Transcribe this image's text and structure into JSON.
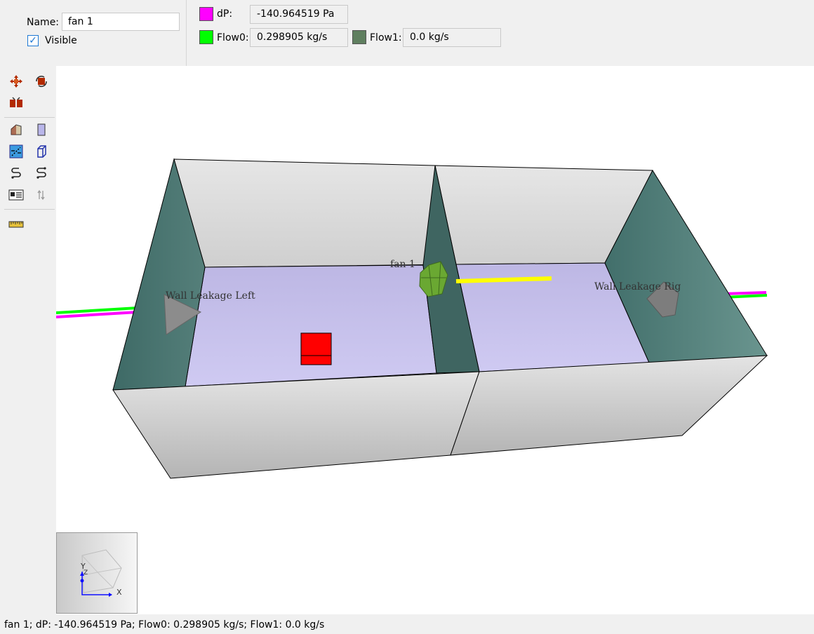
{
  "properties": {
    "name_label": "Name:",
    "name_value": "fan 1",
    "visible_label": "Visible",
    "visible_checked": true
  },
  "readouts": {
    "dp": {
      "label": "dP:",
      "value": "-140.964519 Pa",
      "color": "#ff00ff"
    },
    "flow0": {
      "label": "Flow0:",
      "value": "0.298905 kg/s",
      "color": "#00ff00"
    },
    "flow1": {
      "label": "Flow1:",
      "value": "0.0 kg/s",
      "color": "#5f7f5f"
    }
  },
  "toolbar": {
    "icons": [
      "move-icon",
      "rotate-icon",
      "group-icon",
      "room-shape-icon",
      "wall-panel-icon",
      "flow-grid-icon",
      "box-outline-icon",
      "path-link-icon",
      "path-link-alt-icon",
      "table-icon",
      "dimension-icon",
      "ruler-icon"
    ]
  },
  "scene": {
    "labels": {
      "fan": "fan 1",
      "wall_left": "Wall Leakage Left",
      "wall_right": "Wall Leakage Rig"
    },
    "colors": {
      "floor": "#c8c2ec",
      "wall_outer": "#d8d8d8",
      "wall_side": "#4f7f79",
      "fan": "#6aa832",
      "heater": "#ff0000",
      "flow_line": "#ffff00",
      "leak_marker": "#8c8c8c"
    }
  },
  "axis_indicator": {
    "x_label": "X",
    "y_label": "Y",
    "z_label": "Z"
  },
  "status": {
    "text": "fan 1; dP: -140.964519 Pa; Flow0: 0.298905 kg/s; Flow1: 0.0 kg/s"
  }
}
